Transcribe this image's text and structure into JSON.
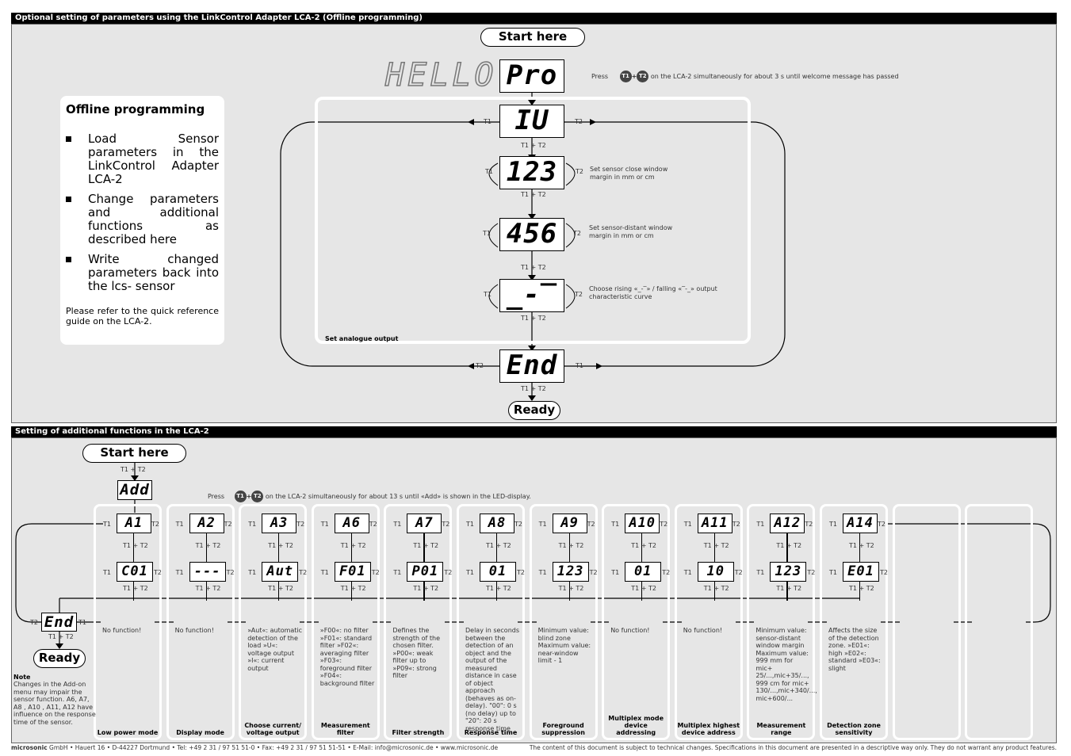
{
  "top": {
    "header": "Optional setting of parameters using the LinkControl Adapter LCA-2 (Offline programming)",
    "start_label": "Start here",
    "hello": "HELLO",
    "press_prefix": "Press",
    "press_suffix": "on the LCA-2 simultaneously for about 3 s until welcome message has passed",
    "key_t1": "T1",
    "key_plus": "+",
    "key_t2": "T2",
    "offline": {
      "title": "Offline programming",
      "bullets": [
        "Load Sensor parameters in the LinkControl Adapter LCA-2",
        "Change parameters and additional functions as described here",
        "Write changed parameters back into the lcs- sensor"
      ],
      "note": "Please refer to the quick reference guide on the LCA-2."
    },
    "displays": {
      "pro": "Pro",
      "iu": "IU",
      "close": "123",
      "far": "456",
      "curve": "_-‾",
      "end": "End"
    },
    "descriptions": {
      "close": "Set sensor close window margin in mm or cm",
      "far": "Set sensor-distant window margin in mm or cm",
      "curve": "Choose rising «_-‾» / falling «‾-_» output characteristic curve"
    },
    "analog_label": "Set analogue output",
    "t1": "T1",
    "t2": "T2",
    "t1t2": "T1 + T2",
    "ready_label": "Ready"
  },
  "bottom": {
    "header": "Setting of additional functions in the LCA-2",
    "start_label": "Start here",
    "add_display": "Add",
    "press_prefix": "Press",
    "press_suffix": "on the LCA-2 simultaneously for about 13 s until «Add» is shown in the LED-display.",
    "end_display": "End",
    "ready_label": "Ready",
    "t1": "T1",
    "t2": "T2",
    "t1t2": "T1 + T2",
    "note_title": "Note",
    "note_text": "Changes in the  Add-on menu may impair the sensor function. A6, A7, A8 , A10 , A11, A12 have influence on the response time of the sensor.",
    "columns": [
      {
        "code": "A1",
        "value": "C01",
        "desc": "No function!",
        "title": "Low power mode"
      },
      {
        "code": "A2",
        "value": "---",
        "desc": "No function!",
        "title": "Display mode"
      },
      {
        "code": "A3",
        "value": "Aut",
        "desc": "»Aut«: automatic detection of the load »U«: voltage output »I«: current output",
        "title": "Choose current/ voltage output"
      },
      {
        "code": "A6",
        "value": "F01",
        "desc": "»F00«: no filter »F01«: standard filter »F02«: averaging filter »F03«: foreground filter »F04«: background filter",
        "title": "Measurement filter"
      },
      {
        "code": "A7",
        "value": "P01",
        "desc": "Defines the strength of the chosen filter. »P00«: weak filter up to »P09«: strong filter",
        "title": "Filter strength"
      },
      {
        "code": "A8",
        "value": "01",
        "desc": "Delay in seconds between the detection of an object and the output of the measured distance in case of object approach (behaves as on-delay). \"00\": 0 s (no delay) up to \"20\": 20 s response time",
        "title": "Response time"
      },
      {
        "code": "A9",
        "value": "123",
        "desc": "Minimum value: blind zone Maximum value: near-window limit - 1",
        "title": "Foreground suppression"
      },
      {
        "code": "A10",
        "value": "01",
        "desc": "No function!",
        "title": "Multiplex mode device addressing"
      },
      {
        "code": "A11",
        "value": "10",
        "desc": "No function!",
        "title": "Multiplex highest device address"
      },
      {
        "code": "A12",
        "value": "123",
        "desc": "Minimum value: sensor-distant window margin Maximum value: 999 mm for mic+ 25/...,mic+35/..., 999 cm for mic+ 130/...,mic+340/..., mic+600/...",
        "title": "Measurement range"
      },
      {
        "code": "A14",
        "value": "E01",
        "desc": "Affects the size of the detection zone. »E01«: high »E02«: standard »E03«: slight",
        "title": "Detection zone sensitivity"
      }
    ]
  },
  "footer": {
    "brand": "microsonic",
    "address": " GmbH • Hauert 16 • D-44227 Dortmund • Tel: +49 2 31 / 97 51 51-0 • Fax: +49 2 31 / 97 51 51-51 • E-Mail: info@microsonic.de • www.microsonic.de",
    "disclaimer": "The content of this document is subject to technical changes. Specifications in this document are presented in a descriptive way only. They do not warrant any product features."
  }
}
